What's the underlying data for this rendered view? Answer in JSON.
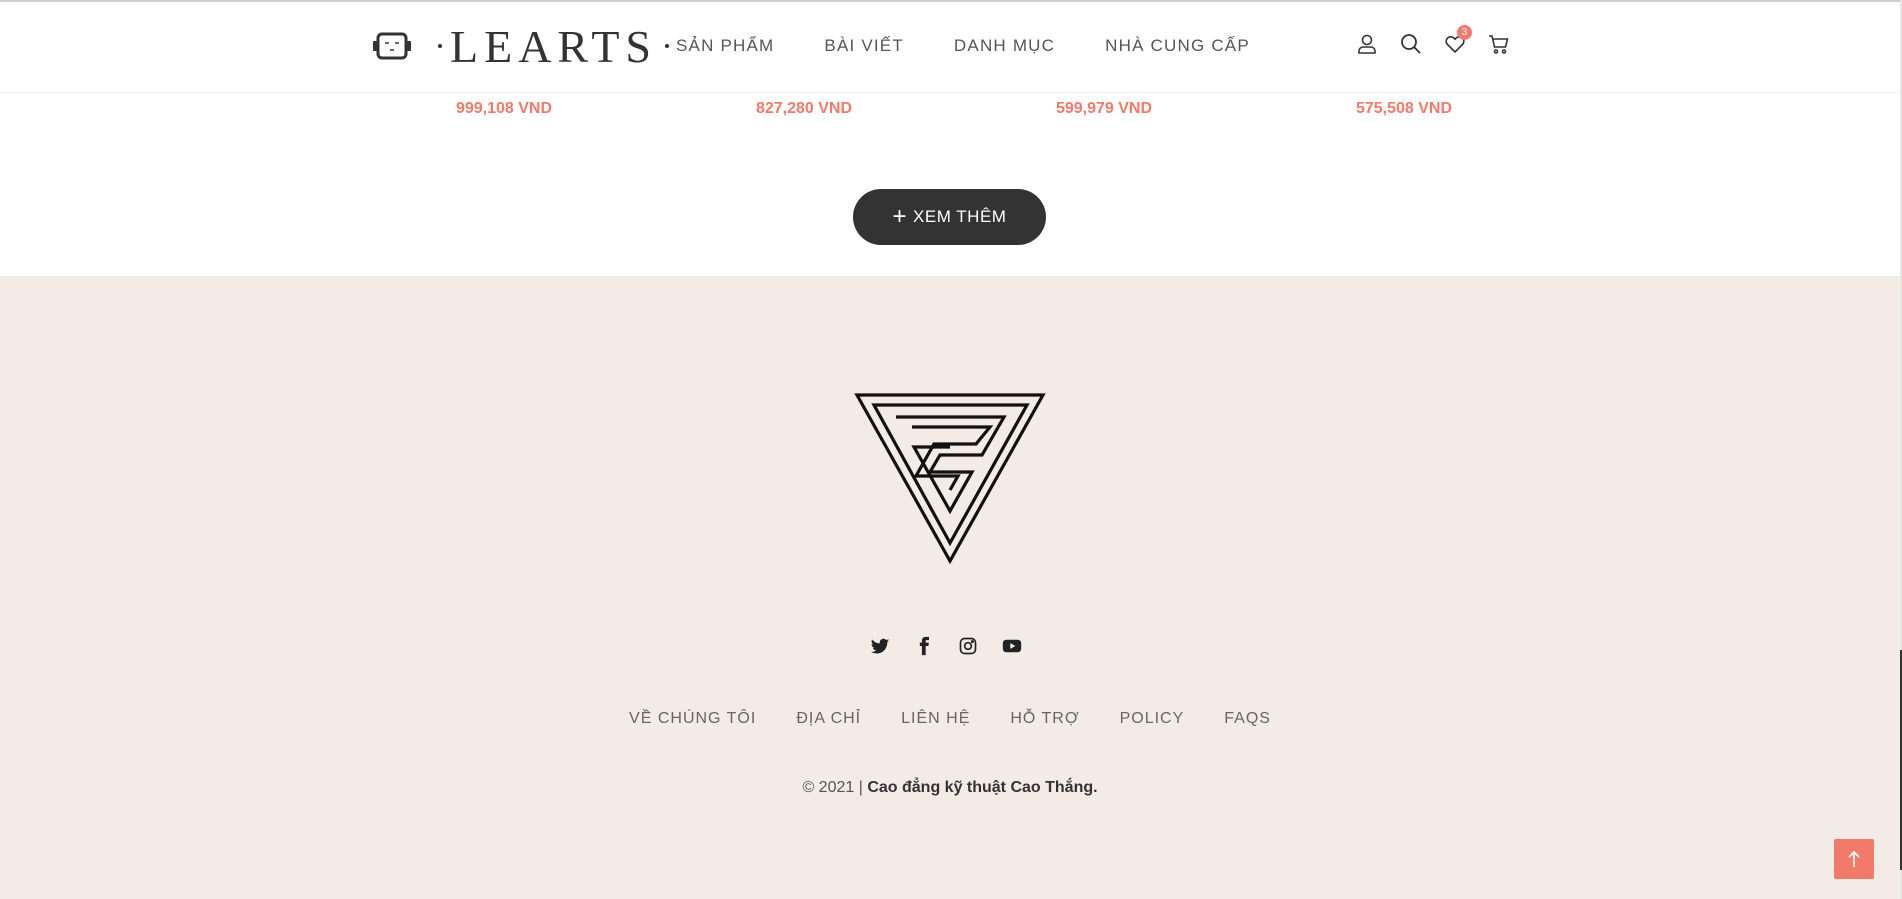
{
  "header": {
    "logo_text": "LEARTS",
    "nav": [
      "SẢN PHẨM",
      "BÀI VIẾT",
      "DANH MỤC",
      "NHÀ CUNG CẤP"
    ],
    "wishlist_count": "3"
  },
  "products": {
    "prices": [
      "999,108 VND",
      "827,280 VND",
      "599,979 VND",
      "575,508 VND"
    ]
  },
  "more_button": {
    "icon": "+",
    "label": "XEM THÊM"
  },
  "footer": {
    "social_icons": [
      "twitter-icon",
      "facebook-icon",
      "instagram-icon",
      "youtube-icon"
    ],
    "links": [
      "VỀ CHÚNG TÔI",
      "ĐỊA CHỈ",
      "LIÊN HỆ",
      "HỖ TRỢ",
      "POLICY",
      "FAQS"
    ],
    "copyright_prefix": "© 2021 |",
    "copyright_org": "Cao đẳng kỹ thuật Cao Thắng."
  },
  "colors": {
    "accent": "#f27a6a",
    "footer_bg": "#f3ebe6",
    "button_bg": "#333333"
  }
}
